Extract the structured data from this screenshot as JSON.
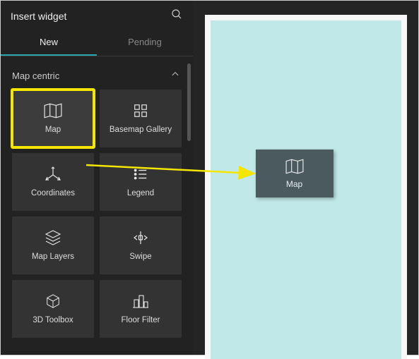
{
  "header": {
    "title": "Insert widget"
  },
  "tabs": {
    "new": "New",
    "pending": "Pending"
  },
  "section": {
    "title": "Map centric"
  },
  "widgets": [
    {
      "id": "map",
      "label": "Map"
    },
    {
      "id": "basemap-gallery",
      "label": "Basemap Gallery"
    },
    {
      "id": "coordinates",
      "label": "Coordinates"
    },
    {
      "id": "legend",
      "label": "Legend"
    },
    {
      "id": "map-layers",
      "label": "Map Layers"
    },
    {
      "id": "swipe",
      "label": "Swipe"
    },
    {
      "id": "3d-toolbox",
      "label": "3D Toolbox"
    },
    {
      "id": "floor-filter",
      "label": "Floor Filter"
    }
  ],
  "dropped": {
    "label": "Map"
  },
  "colors": {
    "highlight": "#f5e600",
    "accent": "#2aa5b0",
    "canvas_page": "#c0e8e8"
  }
}
